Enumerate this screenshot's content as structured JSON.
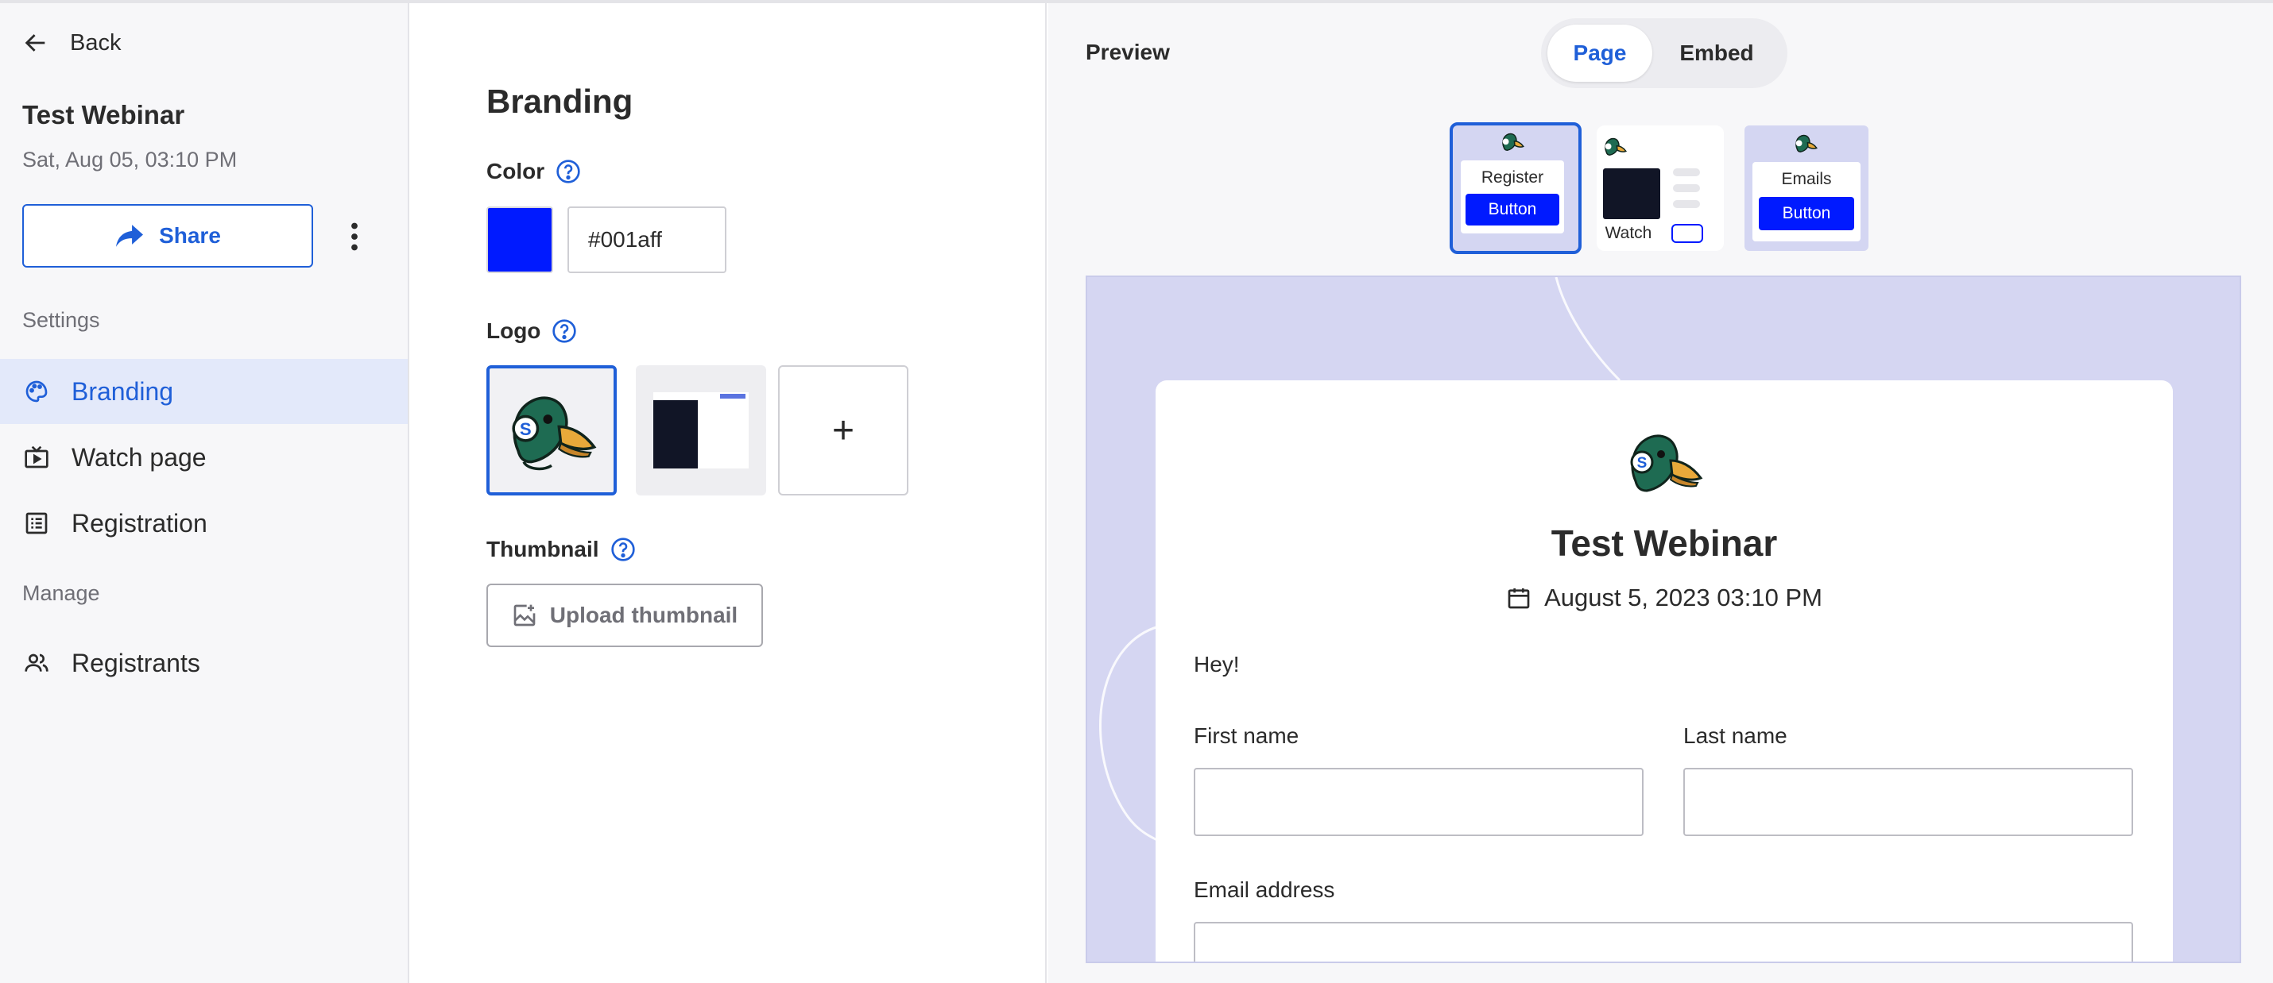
{
  "sidebar": {
    "back_label": "Back",
    "webinar_title": "Test Webinar",
    "webinar_date": "Sat, Aug 05, 03:10 PM",
    "share_label": "Share",
    "settings_heading": "Settings",
    "settings_items": [
      {
        "label": "Branding",
        "icon": "palette-icon",
        "active": true
      },
      {
        "label": "Watch page",
        "icon": "tv-play-icon",
        "active": false
      },
      {
        "label": "Registration",
        "icon": "form-list-icon",
        "active": false
      }
    ],
    "manage_heading": "Manage",
    "manage_items": [
      {
        "label": "Registrants",
        "icon": "people-icon",
        "active": false
      }
    ]
  },
  "branding": {
    "title": "Branding",
    "color_label": "Color",
    "color_value": "#001aff",
    "logo_label": "Logo",
    "thumbnail_label": "Thumbnail",
    "upload_thumbnail_label": "Upload thumbnail",
    "add_logo_symbol": "+"
  },
  "preview": {
    "label": "Preview",
    "tabs": [
      {
        "label": "Page",
        "selected": true
      },
      {
        "label": "Embed",
        "selected": false
      }
    ],
    "thumbnails": [
      {
        "label": "Register",
        "button": "Button",
        "selected": true
      },
      {
        "label": "Watch",
        "selected": false
      },
      {
        "label": "Emails",
        "button": "Button",
        "selected": false
      }
    ],
    "page": {
      "title": "Test Webinar",
      "date": "August 5, 2023 03:10 PM",
      "intro": "Hey!",
      "first_name_label": "First name",
      "last_name_label": "Last name",
      "email_label": "Email address"
    }
  },
  "colors": {
    "accent": "#1f5fd8",
    "brand": "#001aff",
    "preview_bg": "#d5d6f2"
  }
}
